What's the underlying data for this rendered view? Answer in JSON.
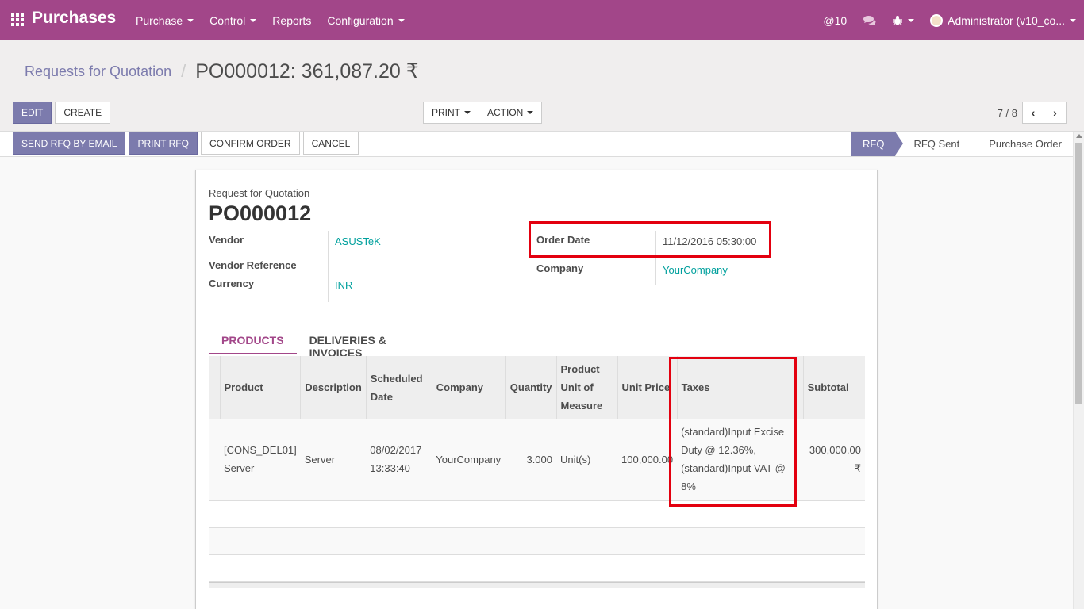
{
  "navbar": {
    "brand": "Purchases",
    "menu": [
      "Purchase",
      "Control",
      "Reports",
      "Configuration"
    ],
    "messages": "@10",
    "user": "Administrator (v10_co..."
  },
  "breadcrumb": {
    "parent": "Requests for Quotation",
    "current": "PO000012: 361,087.20 ₹"
  },
  "buttons": {
    "edit": "EDIT",
    "create": "CREATE",
    "print": "PRINT",
    "action": "ACTION"
  },
  "pager": {
    "value": "7 / 8"
  },
  "statusbar": {
    "buttons": [
      "SEND RFQ BY EMAIL",
      "PRINT RFQ",
      "CONFIRM ORDER",
      "CANCEL"
    ],
    "stages": [
      "RFQ",
      "RFQ Sent",
      "Purchase Order"
    ],
    "active_stage": "RFQ"
  },
  "form": {
    "doc_type": "Request for Quotation",
    "doc_name": "PO000012",
    "vendor_label": "Vendor",
    "vendor": "ASUSTeK",
    "vendor_ref_label": "Vendor Reference",
    "currency_label": "Currency",
    "currency": "INR",
    "order_date_label": "Order Date",
    "order_date": "11/12/2016 05:30:00",
    "company_label": "Company",
    "company": "YourCompany"
  },
  "tabs": [
    "PRODUCTS",
    "DELIVERIES & INVOICES"
  ],
  "table": {
    "headers": [
      "Product",
      "Description",
      "Scheduled Date",
      "Company",
      "Quantity",
      "Product Unit of Measure",
      "Unit Price",
      "Taxes",
      "Subtotal"
    ],
    "rows": [
      {
        "product": "[CONS_DEL01] Server",
        "description": "Server",
        "scheduled_date": "08/02/2017 13:33:40",
        "company": "YourCompany",
        "quantity": "3.000",
        "uom": "Unit(s)",
        "unit_price": "100,000.00",
        "taxes": "(standard)Input Excise Duty @ 12.36%, (standard)Input VAT @ 8%",
        "subtotal": "300,000.00 ₹"
      }
    ]
  },
  "colors": {
    "navbar": "#a24689",
    "primary": "#7c7bad",
    "link": "#00a09d",
    "highlight": "#e3000f"
  }
}
